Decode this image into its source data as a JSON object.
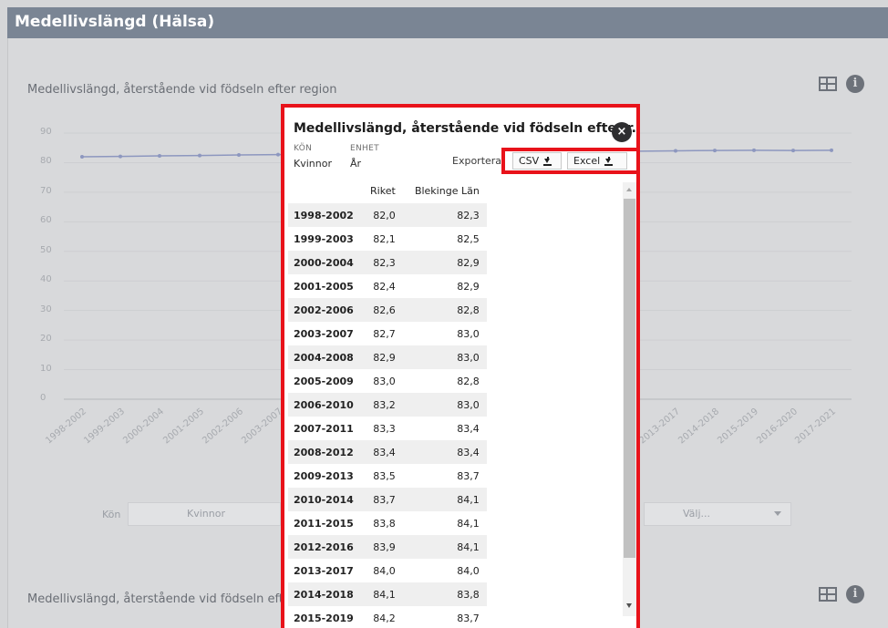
{
  "app": {
    "title": "Medellivslängd (Hälsa)"
  },
  "background": {
    "card1_title": "Medellivslängd, återstående vid födseln efter region",
    "card2_title": "Medellivslängd, återstående vid födseln efter region",
    "filter_label": "Kön",
    "filter_value": "Kvinnor",
    "region_placeholder": "Välj...",
    "info_glyph": "i"
  },
  "chart_data": {
    "type": "line",
    "title": "Medellivslängd, återstående vid födseln efter region",
    "categories": [
      "1998-2002",
      "1999-2003",
      "2000-2004",
      "2001-2005",
      "2002-2006",
      "2003-2007",
      "2013-2017",
      "2014-2018",
      "2015-2019",
      "2016-2020",
      "2017-2021"
    ],
    "series": [
      {
        "name": "Riket",
        "values": [
          82.0,
          82.1,
          82.3,
          82.4,
          82.6,
          82.7,
          84.0,
          84.1,
          84.2,
          84.1,
          84.2
        ]
      }
    ],
    "yticks": [
      "90",
      "80",
      "70",
      "60",
      "50",
      "40",
      "30",
      "20",
      "10",
      "0"
    ],
    "ylim": [
      0,
      90
    ],
    "grid": true
  },
  "modal": {
    "title": "Medellivslängd, återstående vid födseln efter r...",
    "close_glyph": "×",
    "kon_label": "KÖN",
    "kon_value": "Kvinnor",
    "enhet_label": "ENHET",
    "enhet_value": "År",
    "export_label": "Exportera:",
    "csv_label": "CSV",
    "excel_label": "Excel",
    "columns": [
      "",
      "Riket",
      "Blekinge Län"
    ],
    "rows": [
      {
        "period": "1998-2002",
        "riket": "82,0",
        "blekinge": "82,3"
      },
      {
        "period": "1999-2003",
        "riket": "82,1",
        "blekinge": "82,5"
      },
      {
        "period": "2000-2004",
        "riket": "82,3",
        "blekinge": "82,9"
      },
      {
        "period": "2001-2005",
        "riket": "82,4",
        "blekinge": "82,9"
      },
      {
        "period": "2002-2006",
        "riket": "82,6",
        "blekinge": "82,8"
      },
      {
        "period": "2003-2007",
        "riket": "82,7",
        "blekinge": "83,0"
      },
      {
        "period": "2004-2008",
        "riket": "82,9",
        "blekinge": "83,0"
      },
      {
        "period": "2005-2009",
        "riket": "83,0",
        "blekinge": "82,8"
      },
      {
        "period": "2006-2010",
        "riket": "83,2",
        "blekinge": "83,0"
      },
      {
        "period": "2007-2011",
        "riket": "83,3",
        "blekinge": "83,4"
      },
      {
        "period": "2008-2012",
        "riket": "83,4",
        "blekinge": "83,4"
      },
      {
        "period": "2009-2013",
        "riket": "83,5",
        "blekinge": "83,7"
      },
      {
        "period": "2010-2014",
        "riket": "83,7",
        "blekinge": "84,1"
      },
      {
        "period": "2011-2015",
        "riket": "83,8",
        "blekinge": "84,1"
      },
      {
        "period": "2012-2016",
        "riket": "83,9",
        "blekinge": "84,1"
      },
      {
        "period": "2013-2017",
        "riket": "84,0",
        "blekinge": "84,0"
      },
      {
        "period": "2014-2018",
        "riket": "84,1",
        "blekinge": "83,8"
      },
      {
        "period": "2015-2019",
        "riket": "84,2",
        "blekinge": "83,7"
      }
    ]
  },
  "colors": {
    "highlight": "#e8121a",
    "header_bar": "#7a8594",
    "overlay": "#d5d6d8",
    "line": "#8d97bf"
  }
}
